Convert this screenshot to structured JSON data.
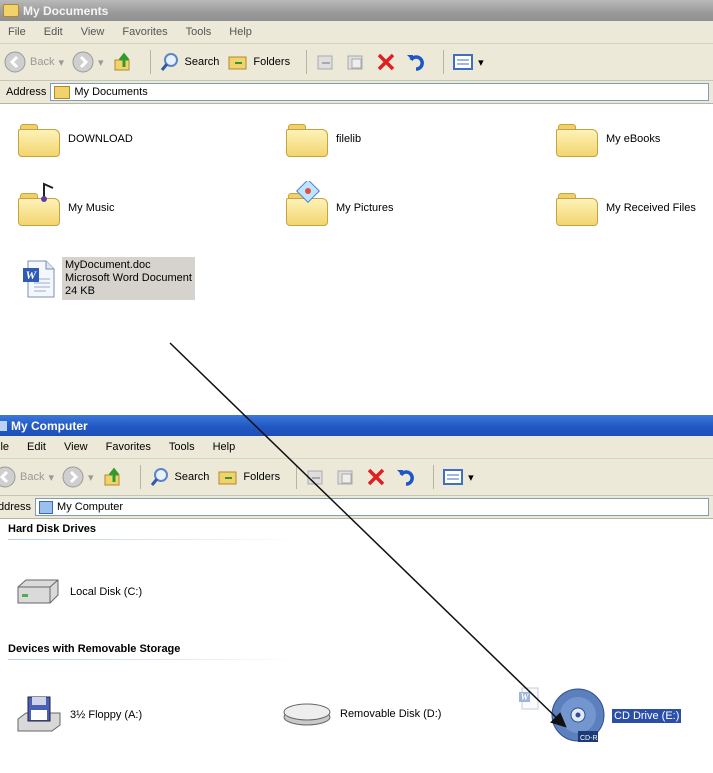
{
  "my_documents": {
    "title": "My Documents",
    "menu": [
      "File",
      "Edit",
      "View",
      "Favorites",
      "Tools",
      "Help"
    ],
    "toolbar": {
      "back": "Back",
      "search": "Search",
      "folders": "Folders"
    },
    "address_label": "Address",
    "address_value": "My Documents",
    "items": [
      {
        "label": "DOWNLOAD"
      },
      {
        "label": "filelib"
      },
      {
        "label": "My eBooks"
      },
      {
        "label": "My Music"
      },
      {
        "label": "My Pictures"
      },
      {
        "label": "My Received Files"
      }
    ],
    "document": {
      "name": "MyDocument.doc",
      "type": "Microsoft Word Document",
      "size": "24 KB"
    }
  },
  "my_computer": {
    "title": "My Computer",
    "menu": [
      "ile",
      "Edit",
      "View",
      "Favorites",
      "Tools",
      "Help"
    ],
    "toolbar": {
      "back": "Back",
      "search": "Search",
      "folders": "Folders"
    },
    "address_label": "ddress",
    "address_value": "My Computer",
    "section_hard": "Hard Disk Drives",
    "section_removable": "Devices with Removable Storage",
    "drives": {
      "local": "Local Disk (C:)",
      "floppy": "3½ Floppy (A:)",
      "removable": "Removable Disk (D:)",
      "cd": "CD Drive (E:)",
      "cd_badge": "CD-R"
    }
  }
}
